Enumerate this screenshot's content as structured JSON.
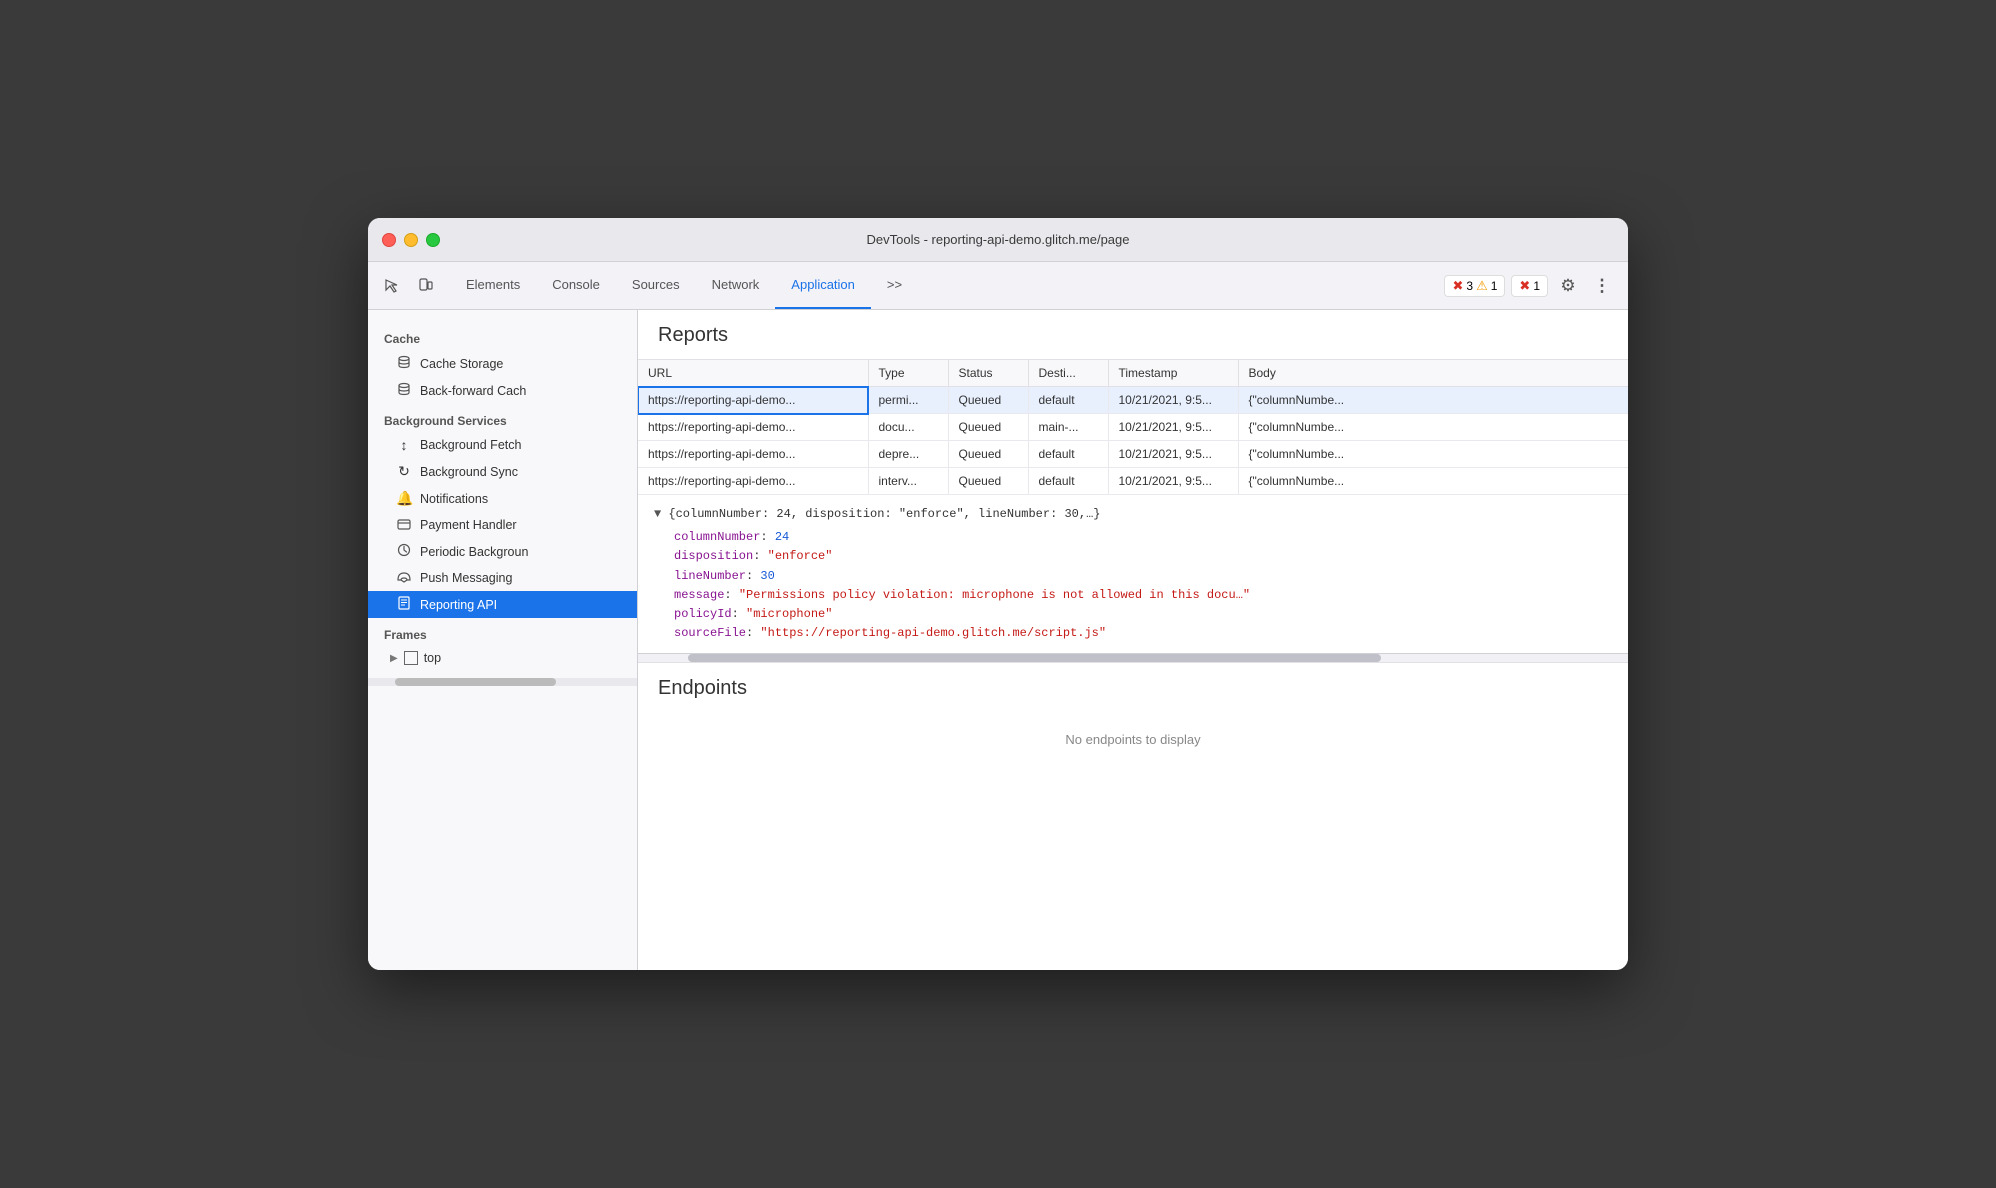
{
  "window": {
    "title": "DevTools - reporting-api-demo.glitch.me/page"
  },
  "toolbar": {
    "tabs": [
      {
        "id": "elements",
        "label": "Elements",
        "active": false
      },
      {
        "id": "console",
        "label": "Console",
        "active": false
      },
      {
        "id": "sources",
        "label": "Sources",
        "active": false
      },
      {
        "id": "network",
        "label": "Network",
        "active": false
      },
      {
        "id": "application",
        "label": "Application",
        "active": true
      }
    ],
    "more_tabs_label": ">>",
    "errors_count": "3",
    "warnings_count": "1",
    "others_count": "1",
    "gear_icon": "⚙",
    "more_icon": "⋮"
  },
  "sidebar": {
    "cache_section": "Cache",
    "cache_items": [
      {
        "id": "cache-storage",
        "icon": "🗄",
        "label": "Cache Storage"
      },
      {
        "id": "back-forward",
        "icon": "🗄",
        "label": "Back-forward Cach"
      }
    ],
    "background_services_section": "Background Services",
    "bg_items": [
      {
        "id": "background-fetch",
        "icon": "↕",
        "label": "Background Fetch"
      },
      {
        "id": "background-sync",
        "icon": "↻",
        "label": "Background Sync"
      },
      {
        "id": "notifications",
        "icon": "🔔",
        "label": "Notifications"
      },
      {
        "id": "payment-handler",
        "icon": "🪪",
        "label": "Payment Handler"
      },
      {
        "id": "periodic-background",
        "icon": "🕐",
        "label": "Periodic Backgroun"
      },
      {
        "id": "push-messaging",
        "icon": "☁",
        "label": "Push Messaging"
      },
      {
        "id": "reporting-api",
        "icon": "📄",
        "label": "Reporting API",
        "active": true
      }
    ],
    "frames_section": "Frames",
    "frames_items": [
      {
        "id": "top",
        "label": "top"
      }
    ]
  },
  "reports": {
    "section_title": "Reports",
    "columns": {
      "url": "URL",
      "type": "Type",
      "status": "Status",
      "destination": "Desti...",
      "timestamp": "Timestamp",
      "body": "Body"
    },
    "rows": [
      {
        "url": "https://reporting-api-demo...",
        "type": "permi...",
        "status": "Queued",
        "destination": "default",
        "timestamp": "10/21/2021, 9:5...",
        "body": "{\"columnNumbe...",
        "selected": true
      },
      {
        "url": "https://reporting-api-demo...",
        "type": "docu...",
        "status": "Queued",
        "destination": "main-...",
        "timestamp": "10/21/2021, 9:5...",
        "body": "{\"columnNumbe...",
        "selected": false
      },
      {
        "url": "https://reporting-api-demo...",
        "type": "depre...",
        "status": "Queued",
        "destination": "default",
        "timestamp": "10/21/2021, 9:5...",
        "body": "{\"columnNumbe...",
        "selected": false
      },
      {
        "url": "https://reporting-api-demo...",
        "type": "interv...",
        "status": "Queued",
        "destination": "default",
        "timestamp": "10/21/2021, 9:5...",
        "body": "{\"columnNumbe...",
        "selected": false
      }
    ],
    "expanded": {
      "summary": "{columnNumber: 24, disposition: \"enforce\", lineNumber: 30,…}",
      "props": [
        {
          "key": "columnNumber",
          "value": "24",
          "type": "number"
        },
        {
          "key": "disposition",
          "value": "\"enforce\"",
          "type": "string"
        },
        {
          "key": "lineNumber",
          "value": "30",
          "type": "number"
        },
        {
          "key": "message",
          "value": "\"Permissions policy violation: microphone is not allowed in this docu…\"",
          "type": "string-long"
        },
        {
          "key": "policyId",
          "value": "\"microphone\"",
          "type": "string"
        },
        {
          "key": "sourceFile",
          "value": "\"https://reporting-api-demo.glitch.me/script.js\"",
          "type": "string"
        }
      ]
    }
  },
  "endpoints": {
    "title": "Endpoints",
    "empty_message": "No endpoints to display"
  }
}
